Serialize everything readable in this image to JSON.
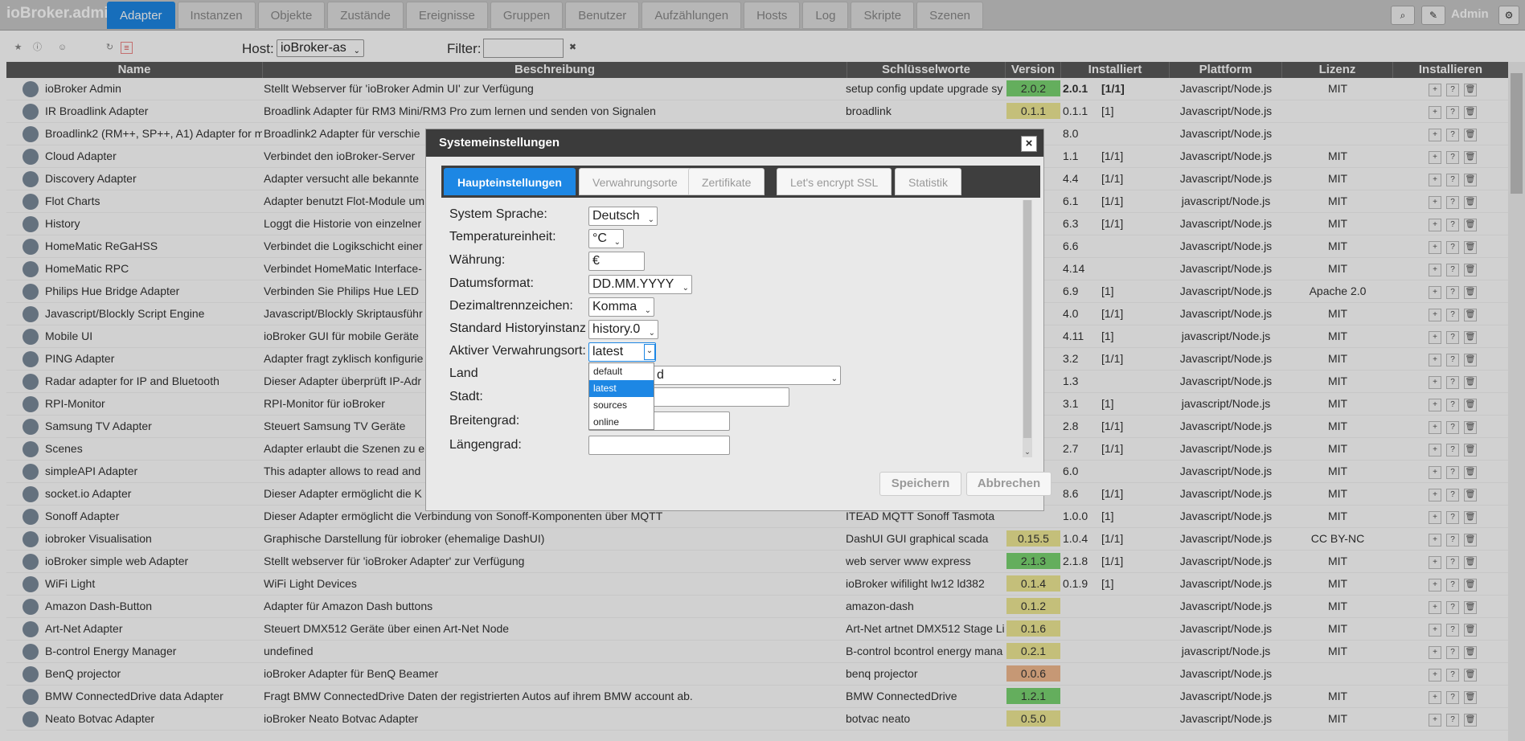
{
  "app": {
    "title": "ioBroker.admin"
  },
  "nav": {
    "tabs": [
      {
        "label": "Adapter",
        "active": true
      },
      {
        "label": "Instanzen"
      },
      {
        "label": "Objekte"
      },
      {
        "label": "Zustände"
      },
      {
        "label": "Ereignisse"
      },
      {
        "label": "Gruppen"
      },
      {
        "label": "Benutzer"
      },
      {
        "label": "Aufzählungen"
      },
      {
        "label": "Hosts"
      },
      {
        "label": "Log"
      },
      {
        "label": "Skripte"
      },
      {
        "label": "Szenen"
      }
    ]
  },
  "header": {
    "user": "Admin",
    "accent": "#1d87e4"
  },
  "toolbar": {
    "host_label": "Host:",
    "host_value": "ioBroker-as",
    "filter_label": "Filter:",
    "filter_value": ""
  },
  "table": {
    "columns": [
      "Name",
      "Beschreibung",
      "Schlüsselworte",
      "Version",
      "Installiert",
      "Plattform",
      "Lizenz",
      "Installieren"
    ],
    "rows": [
      {
        "name": "ioBroker Admin",
        "desc": "Stellt Webserver für 'ioBroker Admin UI' zur Verfügung",
        "keywords": "setup config update upgrade sy",
        "version": "2.0.2",
        "vcolor": "g",
        "installed": "2.0.1",
        "inst": "[1/1]",
        "platform": "Javascript/Node.js",
        "license": "MIT"
      },
      {
        "name": "IR Broadlink Adapter",
        "desc": "Broadlink Adapter für RM3 Mini/RM3 Pro zum lernen und senden von Signalen",
        "keywords": "broadlink",
        "version": "0.1.1",
        "vcolor": "y",
        "installed": "0.1.1",
        "inst": "[1]",
        "platform": "Javascript/Node.js",
        "license": ""
      },
      {
        "name": "Broadlink2 (RM++, SP++, A1) Adapter for m",
        "desc": "Broadlink2 Adapter für verschie",
        "keywords": "",
        "version": "",
        "vcolor": "",
        "installed": "8.0",
        "inst": "",
        "platform": "Javascript/Node.js",
        "license": ""
      },
      {
        "name": "Cloud Adapter",
        "desc": "Verbindet den ioBroker-Server",
        "keywords": "",
        "version": "",
        "vcolor": "",
        "installed": "1.1",
        "inst": "[1/1]",
        "platform": "Javascript/Node.js",
        "license": "MIT"
      },
      {
        "name": "Discovery Adapter",
        "desc": "Adapter versucht alle bekannte",
        "keywords": "",
        "version": "",
        "vcolor": "",
        "installed": "4.4",
        "inst": "[1/1]",
        "platform": "Javascript/Node.js",
        "license": "MIT"
      },
      {
        "name": "Flot Charts",
        "desc": "Adapter benutzt Flot-Module um",
        "keywords": "",
        "version": "",
        "vcolor": "",
        "installed": "6.1",
        "inst": "[1/1]",
        "platform": "javascript/Node.js",
        "license": "MIT"
      },
      {
        "name": "History",
        "desc": "Loggt die Historie von einzelner",
        "keywords": "",
        "version": "",
        "vcolor": "",
        "installed": "6.3",
        "inst": "[1/1]",
        "platform": "Javascript/Node.js",
        "license": "MIT"
      },
      {
        "name": "HomeMatic ReGaHSS",
        "desc": "Verbindet die Logikschicht einer",
        "keywords": "",
        "version": "",
        "vcolor": "",
        "installed": "6.6",
        "inst": "",
        "platform": "Javascript/Node.js",
        "license": "MIT"
      },
      {
        "name": "HomeMatic RPC",
        "desc": "Verbindet HomeMatic Interface-",
        "keywords": "",
        "version": "",
        "vcolor": "",
        "installed": "4.14",
        "inst": "",
        "platform": "Javascript/Node.js",
        "license": "MIT"
      },
      {
        "name": "Philips Hue Bridge Adapter",
        "desc": "Verbinden Sie Philips Hue LED",
        "keywords": "",
        "version": "",
        "vcolor": "",
        "installed": "6.9",
        "inst": "[1]",
        "platform": "Javascript/Node.js",
        "license": "Apache 2.0"
      },
      {
        "name": "Javascript/Blockly Script Engine",
        "desc": "Javascript/Blockly Skriptausführ",
        "keywords": "",
        "version": "",
        "vcolor": "",
        "installed": "4.0",
        "inst": "[1/1]",
        "platform": "Javascript/Node.js",
        "license": "MIT"
      },
      {
        "name": "Mobile UI",
        "desc": "ioBroker GUI für mobile Geräte",
        "keywords": "",
        "version": "",
        "vcolor": "",
        "installed": "4.11",
        "inst": "[1]",
        "platform": "javascript/Node.js",
        "license": "MIT"
      },
      {
        "name": "PING Adapter",
        "desc": "Adapter fragt zyklisch konfigurie",
        "keywords": "",
        "version": "",
        "vcolor": "",
        "installed": "3.2",
        "inst": "[1/1]",
        "platform": "Javascript/Node.js",
        "license": "MIT"
      },
      {
        "name": "Radar adapter for IP and Bluetooth",
        "desc": "Dieser Adapter überprüft IP-Adr",
        "keywords": "",
        "version": "",
        "vcolor": "",
        "installed": "1.3",
        "inst": "",
        "platform": "Javascript/Node.js",
        "license": "MIT"
      },
      {
        "name": "RPI-Monitor",
        "desc": "RPI-Monitor für ioBroker",
        "keywords": "",
        "version": "",
        "vcolor": "",
        "installed": "3.1",
        "inst": "[1]",
        "platform": "javascript/Node.js",
        "license": "MIT"
      },
      {
        "name": "Samsung TV Adapter",
        "desc": "Steuert Samsung TV Geräte",
        "keywords": "",
        "version": "",
        "vcolor": "",
        "installed": "2.8",
        "inst": "[1/1]",
        "platform": "Javascript/Node.js",
        "license": "MIT"
      },
      {
        "name": "Scenes",
        "desc": "Adapter erlaubt die Szenen zu e",
        "keywords": "",
        "version": "",
        "vcolor": "",
        "installed": "2.7",
        "inst": "[1/1]",
        "platform": "Javascript/Node.js",
        "license": "MIT"
      },
      {
        "name": "simpleAPI Adapter",
        "desc": "This adapter allows to read and",
        "keywords": "",
        "version": "",
        "vcolor": "",
        "installed": "6.0",
        "inst": "",
        "platform": "Javascript/Node.js",
        "license": "MIT"
      },
      {
        "name": "socket.io Adapter",
        "desc": "Dieser Adapter ermöglicht die K",
        "keywords": "",
        "version": "",
        "vcolor": "",
        "installed": "8.6",
        "inst": "[1/1]",
        "platform": "Javascript/Node.js",
        "license": "MIT"
      },
      {
        "name": "Sonoff Adapter",
        "desc": "Dieser Adapter ermöglicht die Verbindung von Sonoff-Komponenten über MQTT",
        "keywords": "ITEAD MQTT Sonoff Tasmota",
        "version": "",
        "vcolor": "",
        "installed": "1.0.0",
        "inst": "[1]",
        "platform": "Javascript/Node.js",
        "license": "MIT"
      },
      {
        "name": "iobroker Visualisation",
        "desc": "Graphische Darstellung für iobroker (ehemalige DashUI)",
        "keywords": "DashUI GUI graphical scada",
        "version": "0.15.5",
        "vcolor": "y",
        "installed": "1.0.4",
        "inst": "[1/1]",
        "platform": "Javascript/Node.js",
        "license": "CC BY-NC"
      },
      {
        "name": "ioBroker simple web Adapter",
        "desc": "Stellt webserver für 'ioBroker Adapter' zur Verfügung",
        "keywords": "web server www express",
        "version": "2.1.3",
        "vcolor": "g",
        "installed": "2.1.8",
        "inst": "[1/1]",
        "platform": "Javascript/Node.js",
        "license": "MIT"
      },
      {
        "name": "WiFi Light",
        "desc": "WiFi Light Devices",
        "keywords": "ioBroker wifilight lw12 ld382",
        "version": "0.1.4",
        "vcolor": "y",
        "installed": "0.1.9",
        "inst": "[1]",
        "platform": "Javascript/Node.js",
        "license": "MIT"
      },
      {
        "name": "Amazon Dash-Button",
        "desc": "Adapter für Amazon Dash buttons",
        "keywords": "amazon-dash",
        "version": "0.1.2",
        "vcolor": "y",
        "installed": "",
        "inst": "",
        "platform": "Javascript/Node.js",
        "license": "MIT"
      },
      {
        "name": "Art-Net Adapter",
        "desc": "Steuert DMX512 Geräte über einen Art-Net Node",
        "keywords": "Art-Net artnet DMX512 Stage Li",
        "version": "0.1.6",
        "vcolor": "y",
        "installed": "",
        "inst": "",
        "platform": "Javascript/Node.js",
        "license": "MIT"
      },
      {
        "name": "B-control Energy Manager",
        "desc": "undefined",
        "keywords": "B-control bcontrol energy mana",
        "version": "0.2.1",
        "vcolor": "y",
        "installed": "",
        "inst": "",
        "platform": "javascript/Node.js",
        "license": "MIT"
      },
      {
        "name": "BenQ projector",
        "desc": "ioBroker Adapter für BenQ Beamer",
        "keywords": "benq projector",
        "version": "0.0.6",
        "vcolor": "o",
        "installed": "",
        "inst": "",
        "platform": "Javascript/Node.js",
        "license": ""
      },
      {
        "name": "BMW ConnectedDrive data Adapter",
        "desc": "Fragt BMW ConnectedDrive Daten der registrierten Autos auf ihrem BMW account ab.",
        "keywords": "BMW ConnectedDrive",
        "version": "1.2.1",
        "vcolor": "g",
        "installed": "",
        "inst": "",
        "platform": "Javascript/Node.js",
        "license": "MIT"
      },
      {
        "name": "Neato Botvac Adapter",
        "desc": "ioBroker Neato Botvac Adapter",
        "keywords": "botvac neato",
        "version": "0.5.0",
        "vcolor": "y",
        "installed": "",
        "inst": "",
        "platform": "Javascript/Node.js",
        "license": "MIT"
      }
    ]
  },
  "dialog": {
    "title": "Systemeinstellungen",
    "tabs": [
      "Haupteinstellungen",
      "Verwahrungsorte",
      "Zertifikate",
      "Let's encrypt SSL",
      "Statistik"
    ],
    "fields": {
      "language_label": "System Sprache:",
      "language_value": "Deutsch",
      "temp_label": "Temperatureinheit:",
      "temp_value": "°C",
      "currency_label": "Währung:",
      "currency_value": "€",
      "date_label": "Datumsformat:",
      "date_value": "DD.MM.YYYY",
      "decimal_label": "Dezimaltrennzeichen:",
      "decimal_value": "Komma",
      "history_label": "Standard Historyinstanz",
      "history_value": "history.0",
      "repo_label": "Aktiver Verwahrungsort:",
      "repo_value": "latest",
      "country_label": "Land",
      "country_value": "d",
      "city_label": "Stadt:",
      "lat_label": "Breitengrad:",
      "lon_label": "Längengrad:"
    },
    "repo_options": [
      "default",
      "latest",
      "sources",
      "online"
    ],
    "save_label": "Speichern",
    "cancel_label": "Abbrechen"
  }
}
